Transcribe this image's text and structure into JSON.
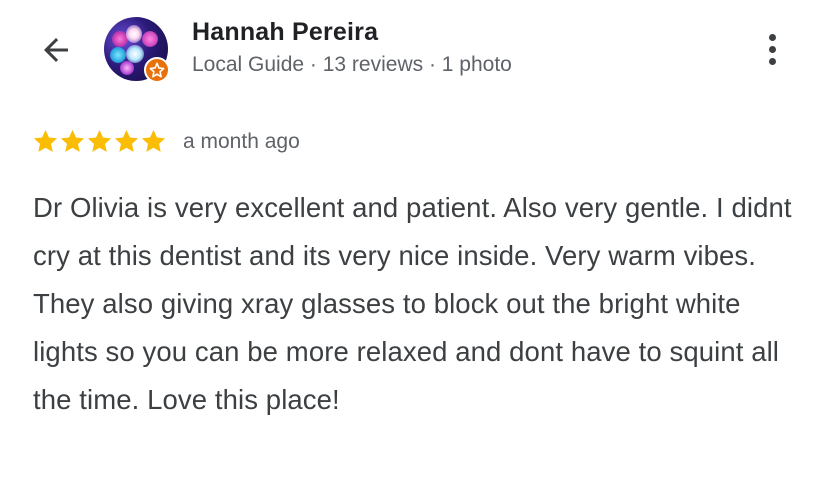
{
  "header": {
    "back_icon": "arrow-back-icon",
    "more_icon": "more-vert-icon"
  },
  "reviewer": {
    "name": "Hannah Pereira",
    "meta": "Local Guide · 13 reviews · 1 photo",
    "badge_icon": "local-guide-star-icon",
    "badge_color": "#e8710a"
  },
  "review": {
    "rating": 5,
    "max_rating": 5,
    "star_color": "#fbbc04",
    "date": "a month ago",
    "text": "Dr Olivia is very excellent and patient. Also very gentle. I didnt cry at this dentist and its very nice inside. Very warm vibes. They also giving xray glasses to block out the bright white lights so you can be more relaxed and dont have to squint all the time. Love this place!"
  }
}
